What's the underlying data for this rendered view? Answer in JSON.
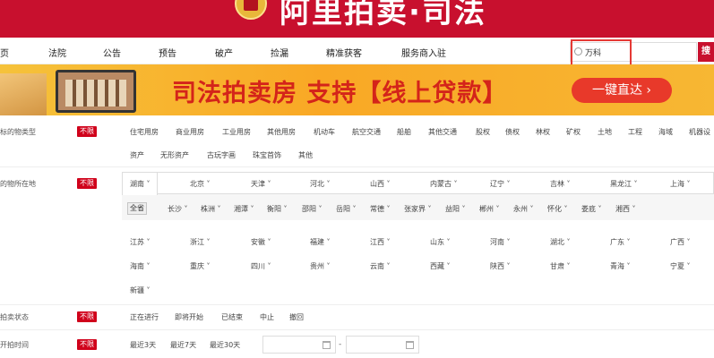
{
  "header": {
    "title": "阿里拍卖·司法"
  },
  "nav": {
    "items": [
      "页",
      "法院",
      "公告",
      "预告",
      "破产",
      "捡漏",
      "精准获客",
      "服务商入驻"
    ],
    "search_value": "万科",
    "search_button": "搜"
  },
  "banner": {
    "title": "司法拍卖房 支持【线上贷款】",
    "button": "一键直达 ›"
  },
  "filters": {
    "unlimited": "不限",
    "type": {
      "label": "标的物类型",
      "row1": [
        "住宅用房",
        "商业用房",
        "工业用房",
        "其他用房",
        "机动车",
        "航空交通",
        "船舶",
        "其他交通",
        "股权",
        "债权",
        "林权",
        "矿权",
        "土地",
        "工程",
        "海域",
        "机器设"
      ],
      "row2": [
        "资产",
        "无形资产",
        "古玩字画",
        "珠宝首饰",
        "其他"
      ]
    },
    "location": {
      "label": "的物所在地",
      "row1": [
        "湖南",
        "北京",
        "天津",
        "河北",
        "山西",
        "内蒙古",
        "辽宁",
        "吉林",
        "黑龙江",
        "上海"
      ],
      "city_all": "全省",
      "cities": [
        "长沙",
        "株洲",
        "湘潭",
        "衡阳",
        "邵阳",
        "岳阳",
        "常德",
        "张家界",
        "益阳",
        "郴州",
        "永州",
        "怀化",
        "娄底",
        "湘西"
      ],
      "row2": [
        "江苏",
        "浙江",
        "安徽",
        "福建",
        "江西",
        "山东",
        "河南",
        "湖北",
        "广东",
        "广西"
      ],
      "row3": [
        "海南",
        "重庆",
        "四川",
        "贵州",
        "云南",
        "西藏",
        "陕西",
        "甘肃",
        "青海",
        "宁夏"
      ],
      "row4": [
        "新疆"
      ]
    },
    "status": {
      "label": "拍卖状态",
      "options": [
        "正在进行",
        "即将开始",
        "已结束",
        "中止",
        "撤回"
      ]
    },
    "start_time": {
      "label": "开拍时间",
      "options": [
        "最近3天",
        "最近7天",
        "最近30天"
      ],
      "dash": "-"
    }
  }
}
